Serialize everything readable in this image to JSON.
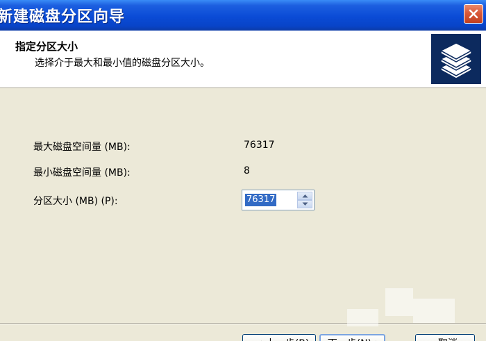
{
  "window": {
    "title": "新建磁盘分区向导"
  },
  "header": {
    "title": "指定分区大小",
    "subtitle": "选择介于最大和最小值的磁盘分区大小。"
  },
  "fields": {
    "max_label": "最大磁盘空间量 (MB):",
    "max_value": "76317",
    "min_label": "最小磁盘空间量 (MB):",
    "min_value": "8",
    "size_label": "分区大小 (MB) (P):",
    "size_value": "76317"
  },
  "buttons": {
    "back": "< 上一步(B)",
    "next": "下一步(N) >",
    "cancel": "取消"
  },
  "colors": {
    "titlebar": "#0A4BD6",
    "dialog_bg": "#ECE9D8",
    "selection": "#316AC5"
  }
}
